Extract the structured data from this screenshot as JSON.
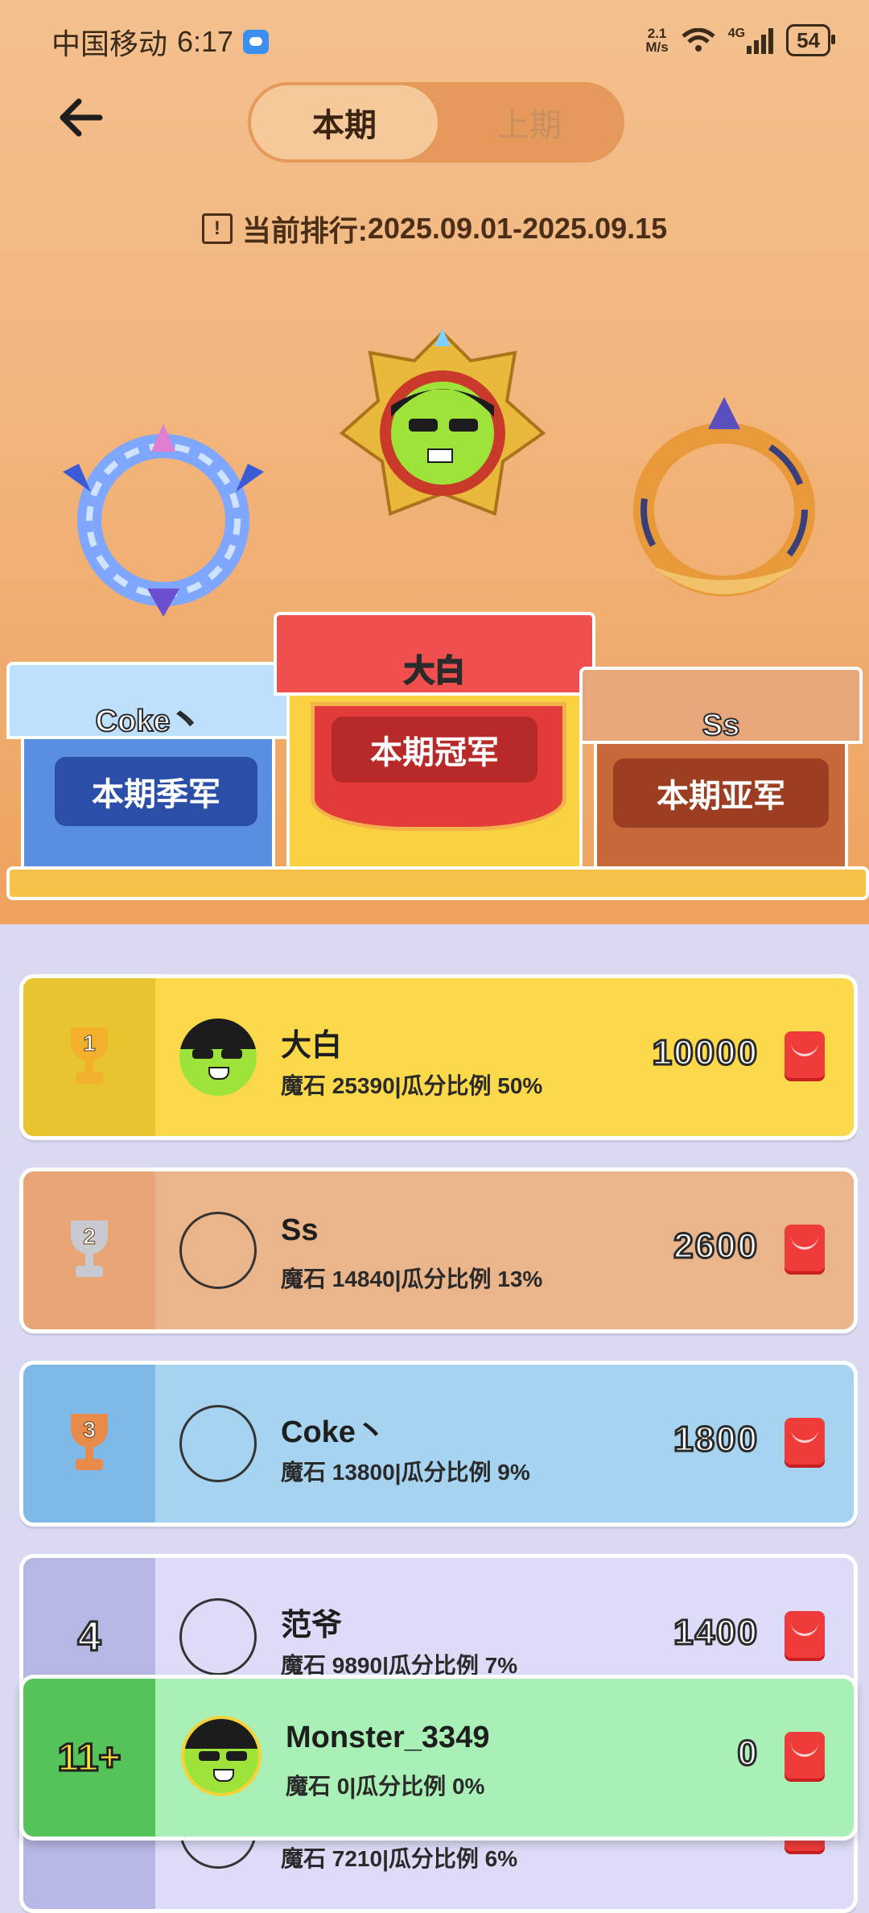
{
  "status_bar": {
    "carrier": "中国移动",
    "time": "6:17",
    "speed_value": "2.1",
    "speed_unit": "M/s",
    "network": "4G",
    "battery": "54"
  },
  "header": {
    "back_icon": "arrow-left-icon",
    "tabs": [
      "本期",
      "上期"
    ],
    "active_tab": "本期"
  },
  "period": {
    "label": "当前排行:",
    "range": "2025.09.01-2025.09.15"
  },
  "podium": {
    "first": {
      "name": "大白",
      "title": "本期冠军"
    },
    "second": {
      "name": "Ss",
      "title": "本期亚军"
    },
    "third": {
      "name": "Coke丶",
      "title": "本期季军"
    }
  },
  "leaderboard": [
    {
      "rank": "1",
      "name": "大白",
      "stats": "魔石 25390|瓜分比例 50%",
      "prize": "10000",
      "color": "#fbd94a",
      "rank_bg": "#e9c431"
    },
    {
      "rank": "2",
      "name": "Ss",
      "stats": "魔石 14840|瓜分比例 13%",
      "prize": "2600",
      "color": "#eab58b",
      "rank_bg": "#e8a676"
    },
    {
      "rank": "3",
      "name": "Coke丶",
      "stats": "魔石 13800|瓜分比例 9%",
      "prize": "1800",
      "color": "#a6d3f0",
      "rank_bg": "#7fb9e8"
    },
    {
      "rank": "4",
      "name": "范爷",
      "stats": "魔石 9890|瓜分比例 7%",
      "prize": "1400",
      "color": "#dcdcf8",
      "rank_bg": "#b7b7e3"
    },
    {
      "rank": "",
      "name": "",
      "stats": "魔石 7210|瓜分比例 6%",
      "prize": "",
      "color": "#dcdcf8",
      "rank_bg": "#b7b7e3"
    }
  ],
  "my_rank": {
    "rank": "11+",
    "name": "Monster_3349",
    "stats": "魔石 0|瓜分比例 0%",
    "prize": "0"
  }
}
